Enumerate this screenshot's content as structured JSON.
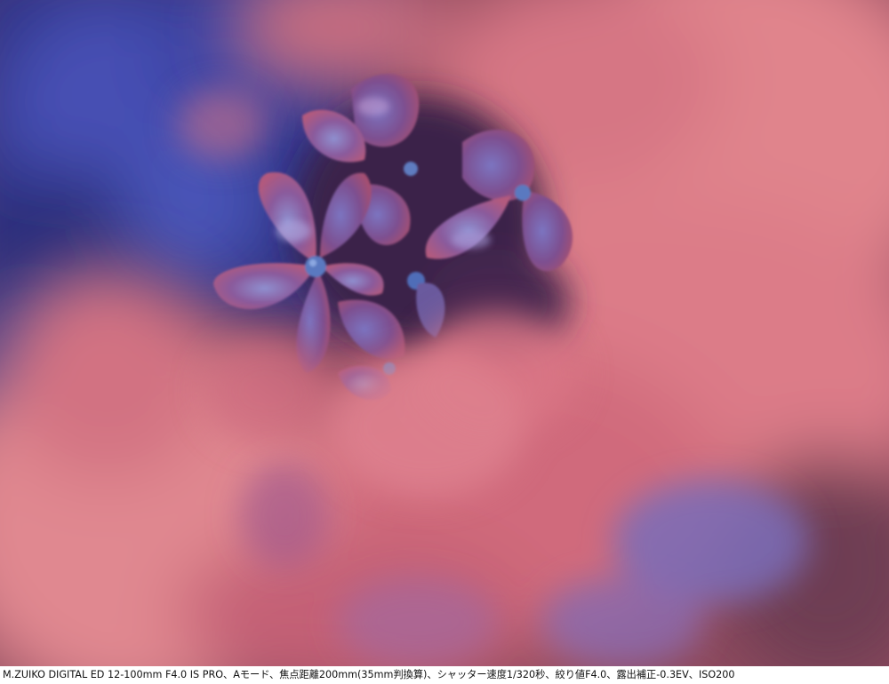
{
  "caption": {
    "text": "M.ZUIKO DIGITAL ED 12-100mm F4.0 IS PRO、Aモード、焦点距離200mm(35mm判換算)、シャッター速度1/320秒、絞り値F4.0、露出補正-0.3EV、ISO200"
  },
  "photo": {
    "subject": "hydrangea-flowers",
    "colors": {
      "background_blue": "#3a3f8f",
      "petal_purple": "#8a5a9c",
      "petal_pink": "#d9707f",
      "blur_pink": "#e0848c",
      "center_blue": "#5a79c0"
    }
  }
}
